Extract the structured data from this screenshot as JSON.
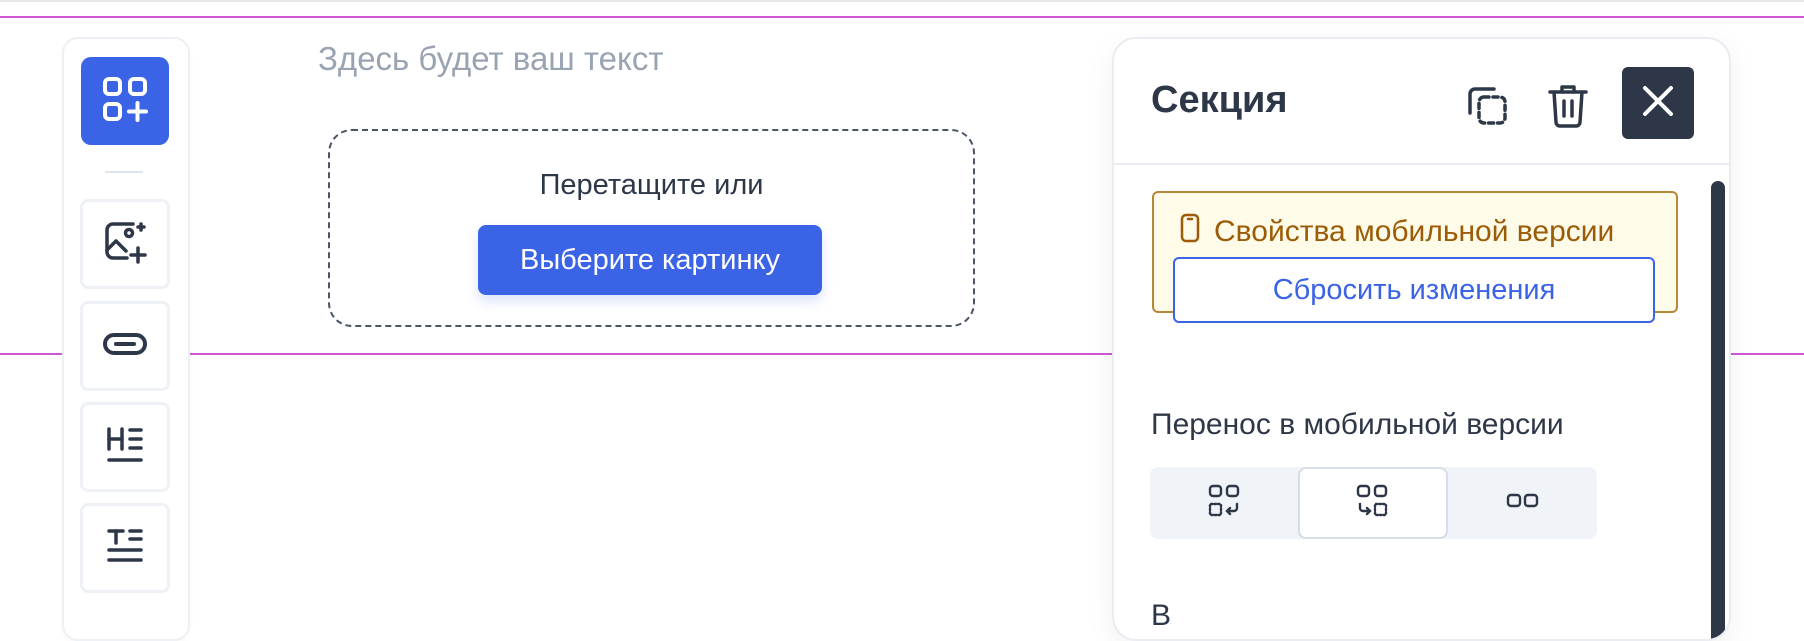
{
  "canvas": {
    "text_placeholder": "Здесь будет ваш текст",
    "dropzone": {
      "hint": "Перетащите или",
      "button_label": "Выберите картинку"
    }
  },
  "toolbar": {
    "items": [
      {
        "icon": "grid-add-icon",
        "active": true
      },
      {
        "icon": "image-add-icon"
      },
      {
        "icon": "button-pill-icon"
      },
      {
        "icon": "heading-icon"
      },
      {
        "icon": "text-icon"
      }
    ]
  },
  "panel": {
    "title": "Секция",
    "actions": [
      "copy-icon",
      "trash-icon",
      "close-icon"
    ],
    "mobile": {
      "title": "Свойства мобильной версии",
      "reset_label": "Сбросить изменения"
    },
    "wrap": {
      "label": "Перенос в мобильной версии",
      "options": [
        "wrap-down-icon",
        "wrap-up-icon",
        "no-wrap-icon"
      ],
      "selected_index": 1
    },
    "next_label": "В"
  },
  "colors": {
    "accent": "#3b63e6",
    "dark": "#2d3748",
    "guide": "#cf57d6",
    "warning_bg": "#fefbe8",
    "warning_border": "#b7873a",
    "warning_text": "#9c5b07"
  }
}
